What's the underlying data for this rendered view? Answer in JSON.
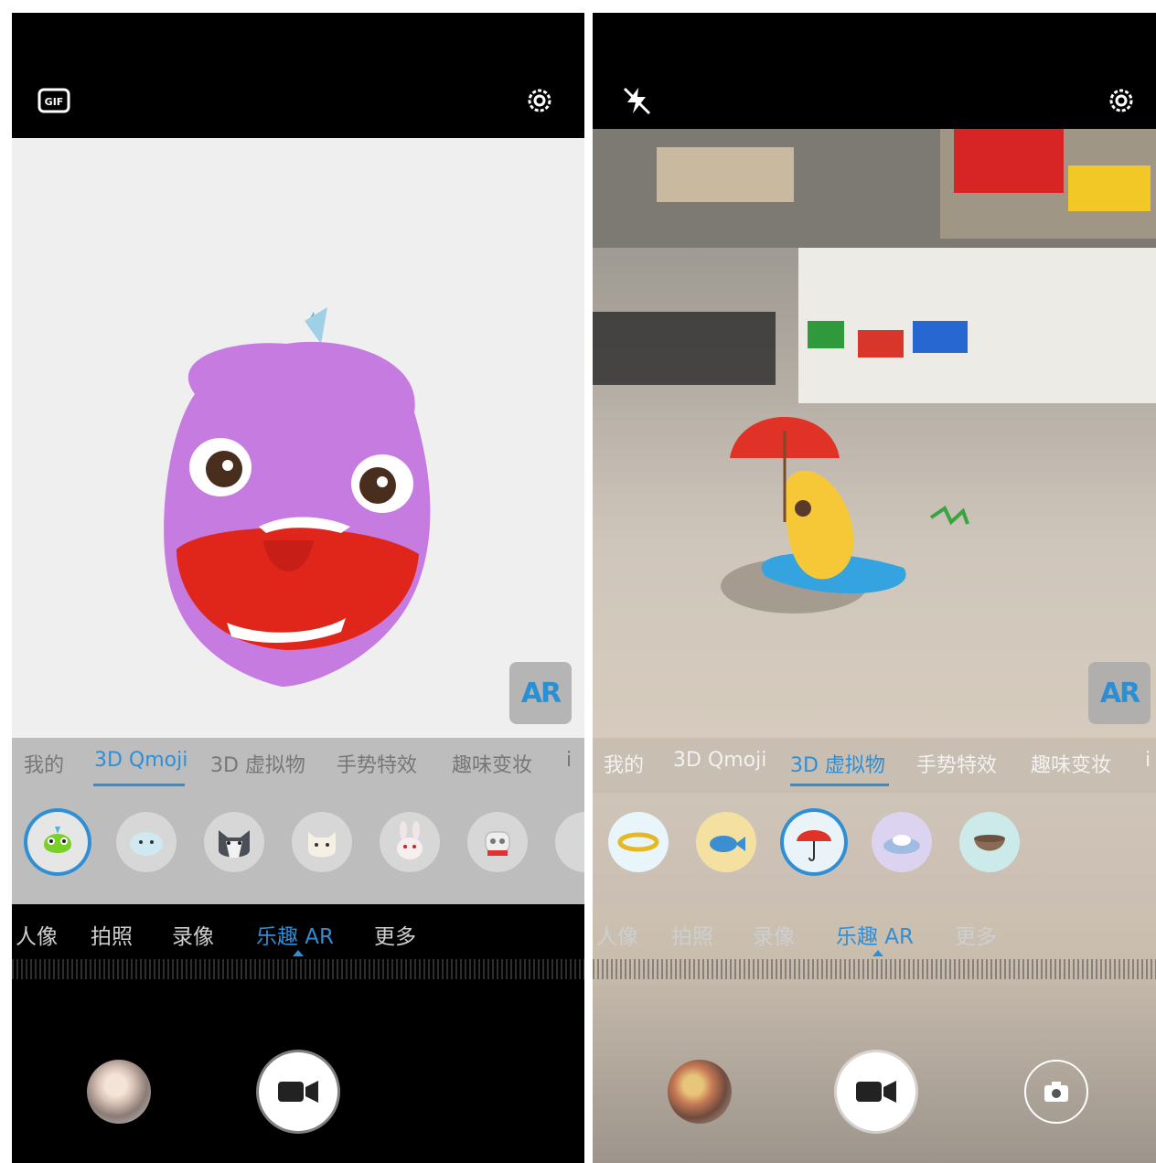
{
  "left": {
    "top_bar": {
      "gif_icon": "gif-icon",
      "settings_icon": "gear-icon"
    },
    "ar_badge": "AR",
    "categories": [
      {
        "label": "我的"
      },
      {
        "label": "3D Qmoji"
      },
      {
        "label": "3D 虚拟物"
      },
      {
        "label": "手势特效"
      },
      {
        "label": "趣味变妆"
      },
      {
        "label": "i"
      }
    ],
    "active_category": "3D Qmoji",
    "items": [
      "chameleon-green",
      "puffer-fish",
      "husky-dog",
      "white-cat",
      "rabbit",
      "robot"
    ],
    "selected_item": "chameleon-green",
    "modes": [
      {
        "label": "人像"
      },
      {
        "label": "拍照"
      },
      {
        "label": "录像"
      },
      {
        "label": "乐趣 AR"
      },
      {
        "label": "更多"
      }
    ],
    "active_mode": "乐趣 AR"
  },
  "right": {
    "top_bar": {
      "flash_icon": "flash-off-icon",
      "settings_icon": "gear-icon"
    },
    "ar_badge": "AR",
    "categories": [
      {
        "label": "我的"
      },
      {
        "label": "3D Qmoji"
      },
      {
        "label": "3D 虚拟物"
      },
      {
        "label": "手势特效"
      },
      {
        "label": "趣味变妆"
      },
      {
        "label": "i"
      }
    ],
    "active_category": "3D 虚拟物",
    "items": [
      "gold-ring",
      "blue-fish",
      "red-umbrella",
      "cloud-island",
      "bowl"
    ],
    "selected_item": "red-umbrella",
    "modes": [
      {
        "label": "人像"
      },
      {
        "label": "拍照"
      },
      {
        "label": "录像"
      },
      {
        "label": "乐趣 AR"
      },
      {
        "label": "更多"
      }
    ],
    "active_mode": "乐趣 AR"
  },
  "colors": {
    "accent": "#2f8fd6",
    "panel": "#cdcdcd",
    "dragon": "#c57be0",
    "mouth": "#e0261b"
  }
}
